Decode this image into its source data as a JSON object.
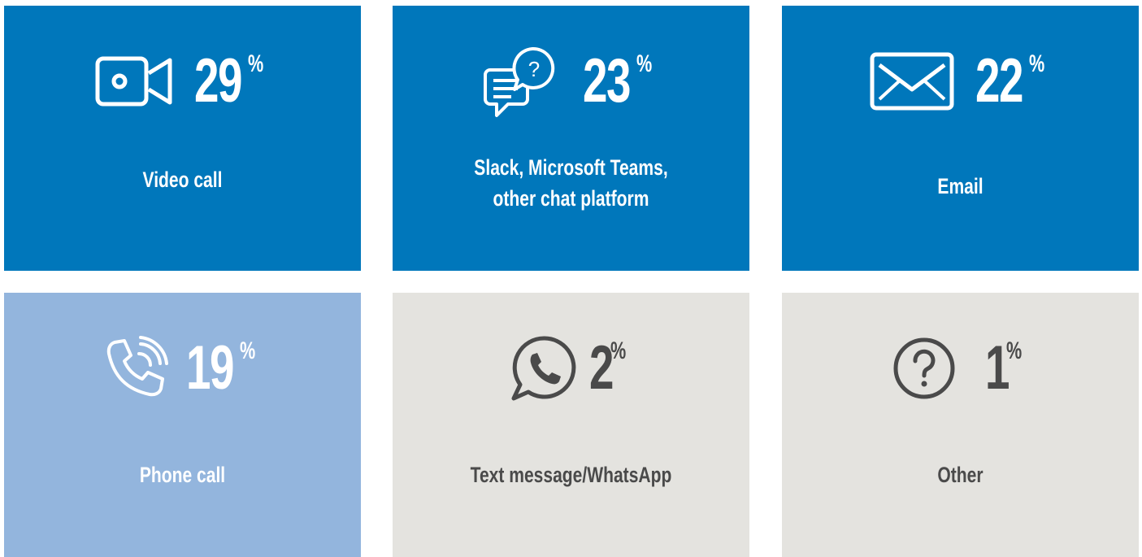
{
  "colors": {
    "dark_blue": "#0077bb",
    "light_blue": "#93b5dd",
    "grey": "#e4e3df",
    "white": "#ffffff",
    "dark_text": "#4a4a4a"
  },
  "tiles": [
    {
      "icon": "video-camera-icon",
      "value": "29",
      "unit": "%",
      "label": "Video call"
    },
    {
      "icon": "chat-question-icon",
      "value": "23",
      "unit": "%",
      "label_line1": "Slack, Microsoft Teams,",
      "label_line2": "other chat platform"
    },
    {
      "icon": "envelope-icon",
      "value": "22",
      "unit": "%",
      "label": "Email"
    },
    {
      "icon": "phone-ringing-icon",
      "value": "19",
      "unit": "%",
      "label": "Phone call"
    },
    {
      "icon": "whatsapp-icon",
      "value": "2",
      "unit": "%",
      "label": "Text message/WhatsApp"
    },
    {
      "icon": "question-circle-icon",
      "value": "1",
      "unit": "%",
      "label": "Other"
    }
  ]
}
